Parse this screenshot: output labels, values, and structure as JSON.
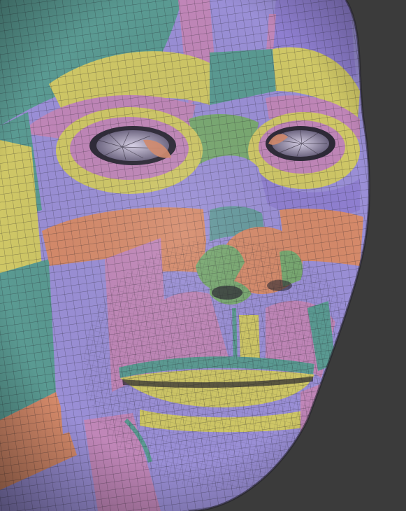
{
  "scene": {
    "subject": "face-mesh-polygroups",
    "background_color": "#3b3b3b",
    "polygroup_colors": {
      "lavender": "#9a8fd6",
      "teal": "#5a9a92",
      "yellow": "#cfc766",
      "orange": "#d58a6a",
      "pink": "#c086b8",
      "green": "#78a870",
      "violet": "#8f7fd0"
    },
    "wire_color": "#1d1b24"
  }
}
